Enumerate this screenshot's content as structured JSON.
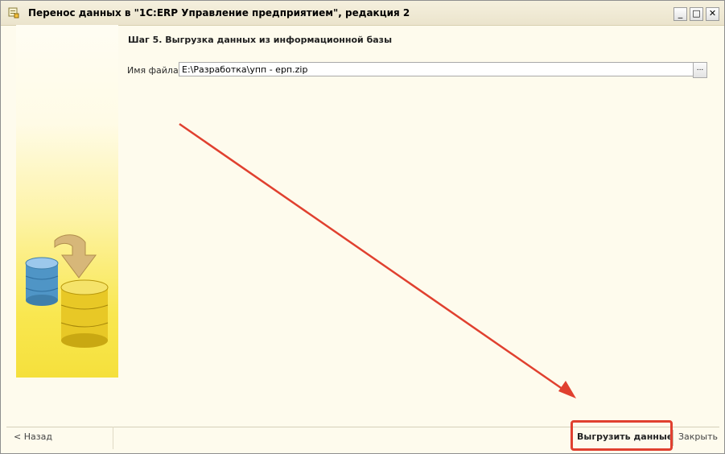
{
  "window": {
    "title": "Перенос данных в \"1С:ERP Управление предприятием\", редакция 2",
    "controls": {
      "minimize": "_",
      "maximize": "□",
      "close": "✕"
    }
  },
  "step": {
    "title": "Шаг 5. Выгрузка данных из информационной базы"
  },
  "file": {
    "label": "Имя файла:",
    "value": "E:\\Разработка\\упп - ерп.zip",
    "browse_label": "..."
  },
  "footer": {
    "back_label": "< Назад",
    "export_label": "Выгрузить данные",
    "close_label": "Закрыть"
  },
  "annotation": {
    "color": "#e0402f"
  },
  "icons": [
    "app-icon",
    "database-icon",
    "transfer-arrow-icon"
  ]
}
